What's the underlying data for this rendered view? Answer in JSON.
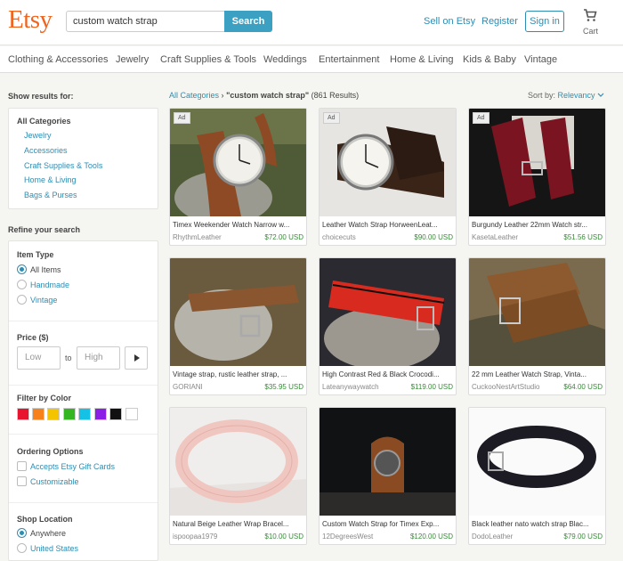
{
  "header": {
    "logo": "Etsy",
    "search_value": "custom watch strap",
    "search_button": "Search",
    "sell_link": "Sell on Etsy",
    "register_link": "Register",
    "signin_button": "Sign in",
    "cart_label": "Cart",
    "cart_icon": "cart-icon",
    "accent_color": "#f1641e",
    "link_color": "#2e8db3"
  },
  "categories": [
    "Clothing & Accessories",
    "Jewelry",
    "Craft Supplies & Tools",
    "Weddings",
    "Entertainment",
    "Home & Living",
    "Kids & Baby",
    "Vintage"
  ],
  "sidebar": {
    "show_results_for": "Show results for:",
    "all_categories": "All Categories",
    "category_links": [
      "Jewelry",
      "Accessories",
      "Craft Supplies & Tools",
      "Home & Living",
      "Bags & Purses"
    ],
    "refine": "Refine your search",
    "item_type": {
      "title": "Item Type",
      "options": [
        "All Items",
        "Handmade",
        "Vintage"
      ],
      "selected": "All Items"
    },
    "price": {
      "title": "Price ($)",
      "low_placeholder": "Low",
      "to": "to",
      "high_placeholder": "High"
    },
    "color": {
      "title": "Filter by Color",
      "swatches": [
        "#e8132e",
        "#f7821b",
        "#f5c400",
        "#33b61f",
        "#16c1e6",
        "#8c1fe6",
        "#111111",
        "#ffffff"
      ]
    },
    "ordering": {
      "title": "Ordering Options",
      "options": [
        "Accepts Etsy Gift Cards",
        "Customizable"
      ]
    },
    "location": {
      "title": "Shop Location",
      "options": [
        "Anywhere",
        "United States"
      ],
      "selected": "Anywhere"
    }
  },
  "results": {
    "crumb_link": "All Categories",
    "crumb_sep": "›",
    "crumb_query": "\"custom watch strap\"",
    "crumb_count": "(861 Results)",
    "sort_label": "Sort by:",
    "sort_value": "Relevancy",
    "listings": [
      {
        "title": "Timex Weekender Watch Narrow w...",
        "shop": "RhythmLeather",
        "price": "$72.00 USD",
        "ad": "Ad"
      },
      {
        "title": "Leather Watch Strap HorweenLeat...",
        "shop": "choicecuts",
        "price": "$90.00 USD",
        "ad": "Ad"
      },
      {
        "title": "Burgundy Leather 22mm Watch str...",
        "shop": "KasetaLeather",
        "price": "$51.56 USD",
        "ad": "Ad"
      },
      {
        "title": "Vintage strap, rustic leather strap, ...",
        "shop": "GORIANI",
        "price": "$35.95 USD",
        "ad": ""
      },
      {
        "title": "High Contrast Red & Black Crocodi...",
        "shop": "Lateanywaywatch",
        "price": "$119.00 USD",
        "ad": ""
      },
      {
        "title": "22 mm Leather Watch Strap, Vinta...",
        "shop": "CuckooNestArtStudio",
        "price": "$64.00 USD",
        "ad": ""
      },
      {
        "title": "Natural Beige Leather Wrap Bracel...",
        "shop": "ispoopaa1979",
        "price": "$10.00 USD",
        "ad": ""
      },
      {
        "title": "Custom Watch Strap for Timex Exp...",
        "shop": "12DegreesWest",
        "price": "$120.00 USD",
        "ad": ""
      },
      {
        "title": "Black leather nato watch strap Blac...",
        "shop": "DodoLeather",
        "price": "$79.00 USD",
        "ad": ""
      }
    ]
  }
}
